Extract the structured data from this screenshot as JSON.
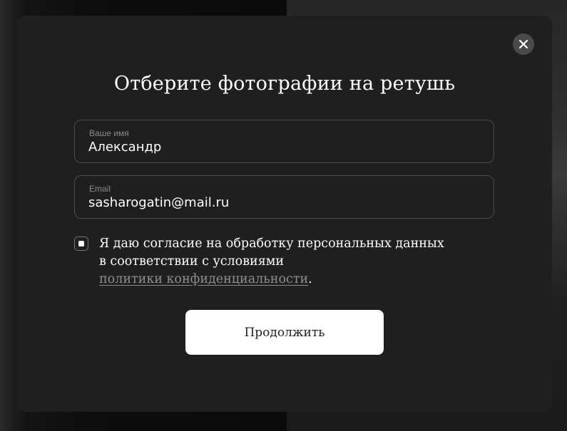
{
  "modal": {
    "title": "Отберите фотографии на ретушь",
    "close_icon": "close-icon"
  },
  "form": {
    "name_field": {
      "label": "Ваше имя",
      "value": "Александр"
    },
    "email_field": {
      "label": "Email",
      "value": "sasharogatin@mail.ru"
    },
    "consent": {
      "checked": true,
      "line1": "Я даю согласие на обработку персональных данных",
      "line2": "в соответствии с условиями",
      "link_text": "политики конфиденциальности",
      "after_link": "."
    },
    "submit_label": "Продолжить"
  },
  "colors": {
    "modal_bg": "#1f1f1f",
    "accent": "#ffffff",
    "link": "#8f8f8f"
  }
}
